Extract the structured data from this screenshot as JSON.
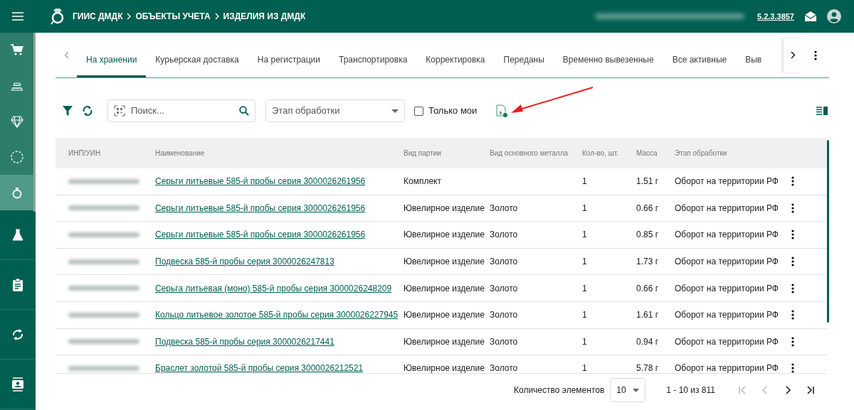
{
  "header": {
    "breadcrumbs": [
      "ГИИС ДМДК",
      "ОБЪЕКТЫ УЧЕТА",
      "ИЗДЕЛИЯ ИЗ ДМДК"
    ],
    "version": "5.2.3.3857"
  },
  "sidebar": {
    "top_items": [
      {
        "kind": "cart",
        "selected": false
      },
      {
        "kind": "bars",
        "selected": false
      },
      {
        "kind": "diamond",
        "selected": false
      },
      {
        "kind": "circle",
        "selected": false
      },
      {
        "kind": "ring",
        "selected": true
      }
    ],
    "bottom_items": [
      {
        "kind": "flask",
        "selected": false
      },
      {
        "kind": "clipboard",
        "selected": false
      },
      {
        "kind": "sync",
        "selected": false
      },
      {
        "kind": "contact",
        "selected": false
      }
    ]
  },
  "tabs": [
    {
      "label": "На хранении",
      "selected": true
    },
    {
      "label": "Курьерская доставка",
      "selected": false
    },
    {
      "label": "На регистрации",
      "selected": false
    },
    {
      "label": "Транспортировка",
      "selected": false
    },
    {
      "label": "Корректировка",
      "selected": false
    },
    {
      "label": "Переданы",
      "selected": false
    },
    {
      "label": "Временно вывезенные",
      "selected": false
    },
    {
      "label": "Все активные",
      "selected": false
    },
    {
      "label": "Выв",
      "selected": false
    }
  ],
  "toolbar": {
    "search": {
      "placeholder": "Поиск..."
    },
    "stage_select": {
      "placeholder": "Этап обработки"
    },
    "only_mine": {
      "label": "Только мои",
      "checked": false
    }
  },
  "table": {
    "columns": [
      "ИНП/УИН",
      "Наименование",
      "Вид партии",
      "Вид основного металла",
      "Кол-во, шт.",
      "Масса",
      "Этап обработки"
    ],
    "rows": [
      {
        "name": "Серьги литьевые 585-й пробы серия 3000026261956",
        "batch": "Комплект",
        "qty": "1",
        "mass": "1.51 г",
        "stage": "Оборот на территории РФ"
      },
      {
        "name": "Серьги литьевые 585-й пробы серия 3000026261956",
        "batch": "Ювелирное изделие",
        "metal": "Золото",
        "qty": "1",
        "mass": "0.66 г",
        "stage": "Оборот на территории РФ"
      },
      {
        "name": "Серьги литьевые 585-й пробы серия 3000026261956",
        "batch": "Ювелирное изделие",
        "metal": "Золото",
        "qty": "1",
        "mass": "0.85 г",
        "stage": "Оборот на территории РФ"
      },
      {
        "name": "Подвеска 585-й пробы серия 3000026247813",
        "batch": "Ювелирное изделие",
        "metal": "Золото",
        "qty": "1",
        "mass": "1.73 г",
        "stage": "Оборот на территории РФ"
      },
      {
        "name": "Серьга литьевая (моно) 585-й пробы серия 3000026248209",
        "batch": "Ювелирное изделие",
        "metal": "Золото",
        "qty": "1",
        "mass": "0.66 г",
        "stage": "Оборот на территории РФ"
      },
      {
        "name": "Кольцо литьевое золотое 585-й пробы серия 3000026227945",
        "batch": "Ювелирное изделие",
        "metal": "Золото",
        "qty": "1",
        "mass": "1.61 г",
        "stage": "Оборот на территории РФ"
      },
      {
        "name": "Подвеска 585-й пробы серия 3000026217441",
        "batch": "Ювелирное изделие",
        "metal": "Золото",
        "qty": "1",
        "mass": "0.94 г",
        "stage": "Оборот на территории РФ"
      },
      {
        "name": "Браслет золотой 585-й пробы серия 3000026212521",
        "batch": "Ювелирное изделие",
        "metal": "Золото",
        "qty": "1",
        "mass": "5.78 г",
        "stage": "Оборот на территории РФ"
      }
    ]
  },
  "footer": {
    "page_size_label": "Количество элементов",
    "page_size": "10",
    "range": "1 - 10 из 811",
    "pager": [
      {
        "kind": "first",
        "disabled": true
      },
      {
        "kind": "prev",
        "disabled": true
      },
      {
        "kind": "next",
        "disabled": false
      },
      {
        "kind": "last",
        "disabled": false
      }
    ]
  }
}
